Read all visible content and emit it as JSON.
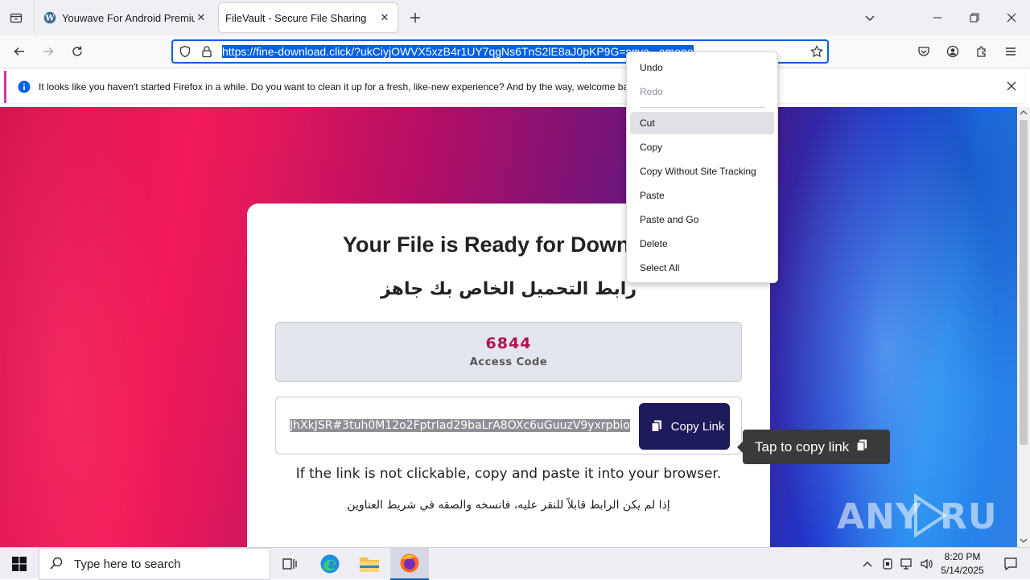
{
  "browser": {
    "tabs": [
      {
        "label": "Youwave For Android Premium",
        "favicon": "wordpress-icon"
      },
      {
        "label": "FileVault - Secure File Sharing",
        "favicon": "none"
      }
    ],
    "url": "https://fine-download.click/?ukCiyjOWVX5xzB4r1UY7qgNs6TnS2lE8aJ0pKP9G=sgva...amono"
  },
  "notification": {
    "text": "It looks like you haven't started Firefox in a while. Do you want to clean it up for a fresh, like-new experience? And by the way, welcome back!"
  },
  "page": {
    "title": "Your File is Ready for Download",
    "title_ar": "رابط التحميل الخاص بك جاهز",
    "access_code": "6844",
    "access_code_label": "Access Code",
    "link_value": "JhXkJSR#3tuh0M12o2FptrIad29baLrA8OXc6uGuuzV9yxrpbio",
    "copy_button": "Copy Link",
    "info_en": "If the link is not clickable, copy and paste it into your browser.",
    "info_ar": "إذا لم يكن الرابط قابلاً للنقر عليه، فانسخه والصقه في شريط العناوين",
    "tooltip": "Tap to copy link",
    "watermark": "ANY RUN"
  },
  "context_menu": {
    "undo": "Undo",
    "redo": "Redo",
    "cut": "Cut",
    "copy": "Copy",
    "copy_no_tracking": "Copy Without Site Tracking",
    "paste": "Paste",
    "paste_go": "Paste and Go",
    "delete": "Delete",
    "select_all": "Select All"
  },
  "taskbar": {
    "search_placeholder": "Type here to search",
    "time": "8:20 PM",
    "date": "5/14/2025"
  },
  "colors": {
    "accent": "#0061e0",
    "button_bg": "#1d1a5a",
    "code_color": "#b0134f"
  }
}
